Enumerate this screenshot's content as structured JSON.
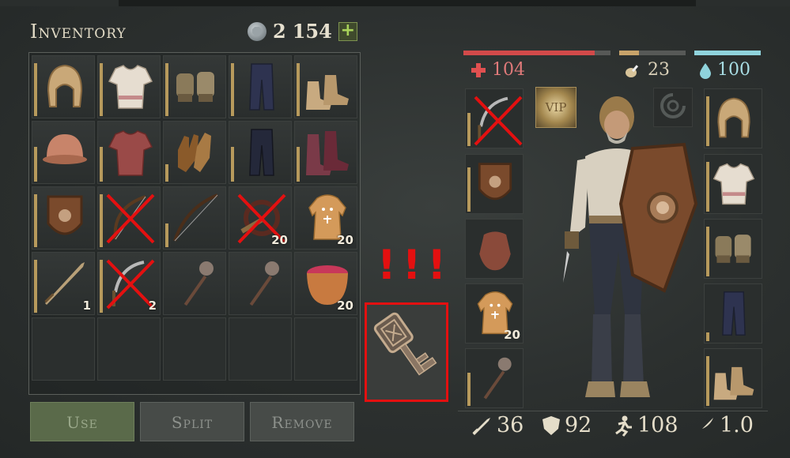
{
  "inventory": {
    "title": "Inventory",
    "currency": {
      "icon": "coin-icon",
      "a": "2",
      "b": "154",
      "add": "+"
    },
    "cells": [
      {
        "icon": "hood-icon",
        "count": "",
        "crossed": false,
        "dur": 0.9
      },
      {
        "icon": "shirt-icon",
        "count": "",
        "crossed": false,
        "dur": 0.9
      },
      {
        "icon": "gloves-icon",
        "count": "",
        "crossed": false,
        "dur": 0.9
      },
      {
        "icon": "pants-icon",
        "count": "",
        "crossed": false,
        "dur": 0.9
      },
      {
        "icon": "boots-icon",
        "count": "",
        "crossed": false,
        "dur": 0.9
      },
      {
        "icon": "helmet-icon",
        "count": "",
        "crossed": false,
        "dur": 0.6
      },
      {
        "icon": "chainmail-icon",
        "count": "",
        "crossed": false,
        "dur": 0.6
      },
      {
        "icon": "leather-gloves-icon",
        "count": "",
        "crossed": false,
        "dur": 0.3
      },
      {
        "icon": "dark-pants-icon",
        "count": "",
        "crossed": false,
        "dur": 0.6
      },
      {
        "icon": "red-boots-icon",
        "count": "",
        "crossed": false,
        "dur": 0.6
      },
      {
        "icon": "shield-icon",
        "count": "",
        "crossed": false,
        "dur": 0.9
      },
      {
        "icon": "bow-icon",
        "count": "",
        "crossed": true,
        "dur": 0.9
      },
      {
        "icon": "longbow-icon",
        "count": "",
        "crossed": false,
        "dur": 0.4
      },
      {
        "icon": "trap-icon",
        "count": "20",
        "crossed": true,
        "dur": 0
      },
      {
        "icon": "ginger-cookie-icon",
        "count": "20",
        "crossed": false,
        "dur": 0
      },
      {
        "icon": "sword-icon",
        "count": "1",
        "crossed": false,
        "dur": 0.9
      },
      {
        "icon": "sickle-icon",
        "count": "2",
        "crossed": true,
        "dur": 0.9
      },
      {
        "icon": "mace-icon",
        "count": "",
        "crossed": false,
        "dur": 0
      },
      {
        "icon": "mace-icon",
        "count": "",
        "crossed": false,
        "dur": 0
      },
      {
        "icon": "berry-bowl-icon",
        "count": "20",
        "crossed": false,
        "dur": 0
      },
      {
        "icon": "",
        "count": "",
        "crossed": false,
        "dur": 0
      },
      {
        "icon": "",
        "count": "",
        "crossed": false,
        "dur": 0
      },
      {
        "icon": "",
        "count": "",
        "crossed": false,
        "dur": 0
      },
      {
        "icon": "",
        "count": "",
        "crossed": false,
        "dur": 0
      },
      {
        "icon": "",
        "count": "",
        "crossed": false,
        "dur": 0
      }
    ],
    "buttons": {
      "use": "Use",
      "split": "Split",
      "remove": "Remove"
    }
  },
  "highlight": {
    "alert": "!!!",
    "item_icon": "key-icon"
  },
  "character": {
    "health": {
      "value": "104",
      "fraction": 0.89,
      "color": "#d24a4a"
    },
    "food": {
      "value": "23",
      "fraction": 0.3,
      "color": "#c8a36a"
    },
    "water": {
      "value": "100",
      "fraction": 1.0,
      "color": "#8fd3dc"
    },
    "vip_label": "VIP",
    "left_slots": [
      {
        "icon": "sickle-icon",
        "crossed": true,
        "count": "",
        "dur": 0.6
      },
      {
        "icon": "shield-icon",
        "crossed": false,
        "count": "",
        "dur": 0.8
      },
      {
        "icon": "pouch-icon",
        "crossed": false,
        "count": "",
        "dur": 0
      },
      {
        "icon": "ginger-cookie-icon",
        "crossed": false,
        "count": "20",
        "dur": 0
      },
      {
        "icon": "mace-icon",
        "crossed": false,
        "count": "",
        "dur": 0.6
      }
    ],
    "right_slots": [
      {
        "icon": "hood-icon",
        "dur": 0.9
      },
      {
        "icon": "shirt-icon",
        "dur": 0.9
      },
      {
        "icon": "gloves-icon",
        "dur": 0.9
      },
      {
        "icon": "pants-icon",
        "dur": 0.15
      },
      {
        "icon": "boots-icon",
        "dur": 0.9
      }
    ],
    "stats": {
      "attack": "36",
      "defense": "92",
      "speed": "108",
      "weight": "1.0"
    }
  }
}
